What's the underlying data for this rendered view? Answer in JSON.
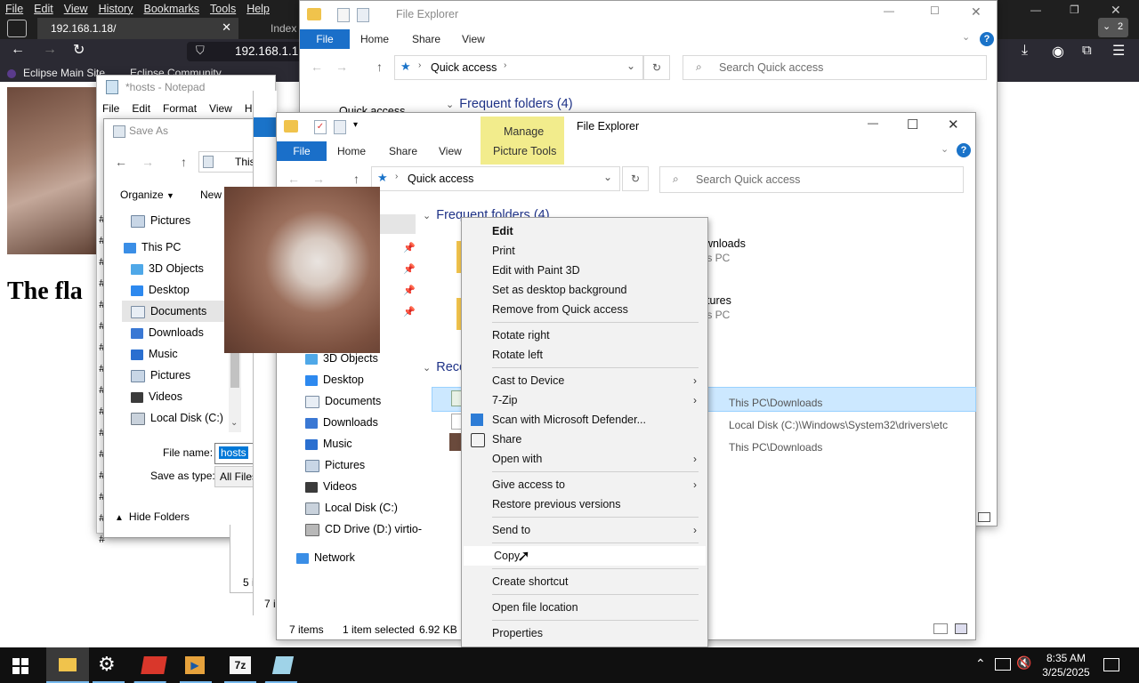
{
  "browser": {
    "menu": [
      "File",
      "Edit",
      "View",
      "History",
      "Bookmarks",
      "Tools",
      "Help"
    ],
    "tab_active": "192.168.1.18/",
    "tab_inactive": "Index",
    "url": "192.168.1.1",
    "bookmarks": [
      "Eclipse Main Site",
      "Eclipse Community"
    ],
    "page_heading": "The fla",
    "tab_count": "2"
  },
  "notepad": {
    "title": "*hosts - Notepad",
    "menu": [
      "File",
      "Edit",
      "Format",
      "View",
      "He"
    ],
    "line_prefix": "#"
  },
  "save_as": {
    "title": "Save As",
    "path_text": "This",
    "organize_label": "Organize",
    "new_label": "New",
    "nav_items": [
      {
        "label": "Pictures",
        "icon": "pictures-icon"
      },
      {
        "label": "This PC",
        "icon": "this-pc-icon"
      },
      {
        "label": "3D Objects",
        "icon": "3d-objects-icon"
      },
      {
        "label": "Desktop",
        "icon": "desktop-icon"
      },
      {
        "label": "Documents",
        "icon": "documents-icon"
      },
      {
        "label": "Downloads",
        "icon": "downloads-icon"
      },
      {
        "label": "Music",
        "icon": "music-icon"
      },
      {
        "label": "Pictures",
        "icon": "pictures-icon"
      },
      {
        "label": "Videos",
        "icon": "videos-icon"
      },
      {
        "label": "Local Disk (C:)",
        "icon": "local-disk-icon"
      }
    ],
    "file_name_label": "File name:",
    "file_name_value": "hosts",
    "save_type_label": "Save as type:",
    "save_type_value": "All Files",
    "hide_folders_label": "Hide Folders"
  },
  "explorer_back": {
    "title": "File Explorer",
    "ribbon_tabs": [
      "File",
      "Home",
      "Share",
      "View"
    ],
    "location": "Quick access",
    "search_placeholder": "Search Quick access",
    "frequent_header": "Frequent folders (4)",
    "nav_first": "Quick access",
    "status_count": "5 i",
    "status_count2": "7 i"
  },
  "explorer_front": {
    "title": "File Explorer",
    "ribbon_tabs": [
      "File",
      "Home",
      "Share",
      "View"
    ],
    "manage_label": "Manage",
    "picture_tools_label": "Picture Tools",
    "location": "Quick access",
    "search_placeholder": "Search Quick access",
    "frequent_header": "Frequent folders (4)",
    "recent_header": "Rece",
    "nav_items": [
      {
        "label": "3D Objects",
        "icon": "3d-objects-icon"
      },
      {
        "label": "Desktop",
        "icon": "desktop-icon"
      },
      {
        "label": "Documents",
        "icon": "documents-icon"
      },
      {
        "label": "Downloads",
        "icon": "downloads-icon"
      },
      {
        "label": "Music",
        "icon": "music-icon"
      },
      {
        "label": "Pictures",
        "icon": "pictures-icon"
      },
      {
        "label": "Videos",
        "icon": "videos-icon"
      },
      {
        "label": "Local Disk (C:)",
        "icon": "local-disk-icon"
      },
      {
        "label": "CD Drive (D:) virtio-",
        "icon": "cd-drive-icon"
      },
      {
        "label": "Network",
        "icon": "network-icon"
      }
    ],
    "frequent_items": [
      {
        "name": "ownloads",
        "sub": "his PC"
      },
      {
        "name": "ictures",
        "sub": "his PC"
      }
    ],
    "recent_paths": [
      "This PC\\Downloads",
      "Local Disk (C:)\\Windows\\System32\\drivers\\etc",
      "This PC\\Downloads"
    ],
    "status_items": "7 items",
    "status_selected": "1 item selected",
    "status_size": "6.92 KB"
  },
  "context_menu": {
    "items": [
      {
        "label": "Edit",
        "bold": true
      },
      {
        "label": "Print"
      },
      {
        "label": "Edit with Paint 3D"
      },
      {
        "label": "Set as desktop background"
      },
      {
        "label": "Remove from Quick access"
      },
      {
        "sep": true
      },
      {
        "label": "Rotate right"
      },
      {
        "label": "Rotate left"
      },
      {
        "sep": true
      },
      {
        "label": "Cast to Device",
        "submenu": true
      },
      {
        "label": "7-Zip",
        "submenu": true
      },
      {
        "label": "Scan with Microsoft Defender...",
        "icon": "defender-icon"
      },
      {
        "label": "Share",
        "icon": "share-icon"
      },
      {
        "label": "Open with",
        "submenu": true
      },
      {
        "sep": true
      },
      {
        "label": "Give access to",
        "submenu": true
      },
      {
        "label": "Restore previous versions"
      },
      {
        "sep": true
      },
      {
        "label": "Send to",
        "submenu": true
      },
      {
        "sep": true
      },
      {
        "label": "Copy",
        "hover": true
      },
      {
        "sep": true
      },
      {
        "label": "Create shortcut"
      },
      {
        "sep": true
      },
      {
        "label": "Open file location"
      },
      {
        "sep": true
      },
      {
        "label": "Properties"
      }
    ]
  },
  "taskbar": {
    "time": "8:35 AM",
    "date": "3/25/2025",
    "apps": [
      "start-icon",
      "file-explorer-icon",
      "settings-icon",
      "app-red-icon",
      "media-player-icon",
      "7zip-icon",
      "notepad-icon"
    ]
  },
  "colors": {
    "accent": "#0067c0",
    "manage_tab": "#f2ec8c",
    "taskbar": "#101010",
    "browser_dark": "#1f1f1f",
    "selection": "#cce8ff"
  }
}
